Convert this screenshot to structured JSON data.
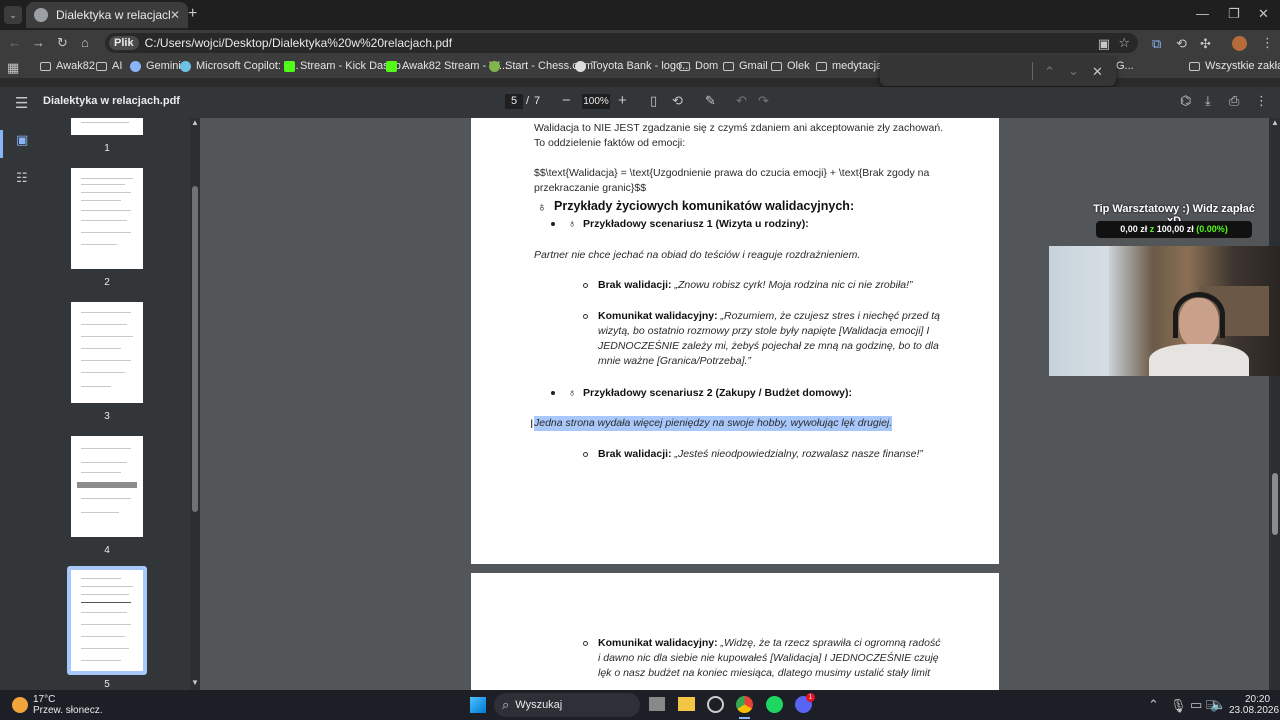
{
  "browser": {
    "tab_title": "Dialektyka w relacjach.pdf",
    "new_tab": "+",
    "address_chip": "Plik",
    "url": "C:/Users/wojci/Desktop/Dialektyka%20w%20relacjach.pdf",
    "bookmarks": [
      "Awak82",
      "AI",
      "Gemini",
      "Microsoft Copilot: T...",
      "Stream - Kick Dashb...",
      "Awak82 Stream - W...",
      "Start - Chess.com",
      "Toyota Bank - logo...",
      "Dom",
      "Gmail",
      "Olek",
      "medytacja",
      "G..."
    ],
    "all_bookmarks": "Wszystkie zakładki"
  },
  "pdf": {
    "title": "Dialektyka w relacjach.pdf",
    "page_current": "5",
    "page_sep": "/",
    "page_total": "7",
    "zoom": "100%"
  },
  "thumbnails": [
    "1",
    "2",
    "3",
    "4",
    "5"
  ],
  "page5": {
    "l1": "Walidacja to NIE JEST zgadzanie się z czymś zdaniem ani akceptowanie zły zachowań.",
    "l2": "To oddzielenie faktów od emocji:",
    "l3": "$$\\text{Walidacja} = \\text{Uzgodnienie prawa do czucia emocji} + \\text{Brak zgody na",
    "l4": "przekraczanie granic}$$",
    "h1": "Przykłady życiowych komunikatów walidacyjnych:",
    "s1": "Przykładowy scenariusz 1 (Wizyta u rodziny):",
    "p1": "Partner nie chce jechać na obiad do teściów i reaguje rozdrażnieniem.",
    "b1_label": "Brak walidacji:",
    "b1_text": "„Znowu robisz cyrk! Moja rodzina nic ci nie zrobiła!”",
    "k1_label": "Komunikat walidacyjny:",
    "k1_l1": "„Rozumiem, że czujesz stres i niechęć przed tą",
    "k1_l2": "wizytą, bo ostatnio rozmowy przy stole były napięte [Walidacja emocji] I",
    "k1_l3": "JEDNOCZEŚNIE zależy mi, żebyś pojechał ze mną na godzinę, bo to dla",
    "k1_l4": "mnie ważne [Granica/Potrzeba].”",
    "s2": "Przykładowy scenariusz 2 (Zakupy / Budżet domowy):",
    "p2": "Jedna strona wydała więcej pieniędzy na swoje hobby, wywołując lęk drugiej.",
    "b2_label": "Brak walidacji:",
    "b2_text": "„Jesteś nieodpowiedzialny, rozwalasz nasze finanse!”"
  },
  "page6": {
    "k2_label": "Komunikat walidacyjny:",
    "k2_l1": "„Widzę, że ta rzecz sprawiła ci ogromną radość",
    "k2_l2": "i dawno nic dla siebie nie kupowałeś [Walidacja] I JEDNOCZEŚNIE czuję",
    "k2_l3": "lęk o nasz budżet na koniec miesiąca, dlatego musimy ustalić stały limit"
  },
  "overlay": {
    "tip_title": "Tip Warsztatowy :) Widz zapłać xD",
    "tip_amount": "0,00 zł",
    "tip_of": "z",
    "tip_goal": "100,00 zł",
    "tip_pct": "(0.00%)"
  },
  "taskbar": {
    "temp": "17°C",
    "weather": "Przew. słonecz.",
    "search": "Wyszukaj",
    "time": "20:20",
    "date": "23.08.2026",
    "badge": "1"
  },
  "colors": {
    "selection": "#a8c7fa",
    "accent": "#8ab4f8"
  }
}
